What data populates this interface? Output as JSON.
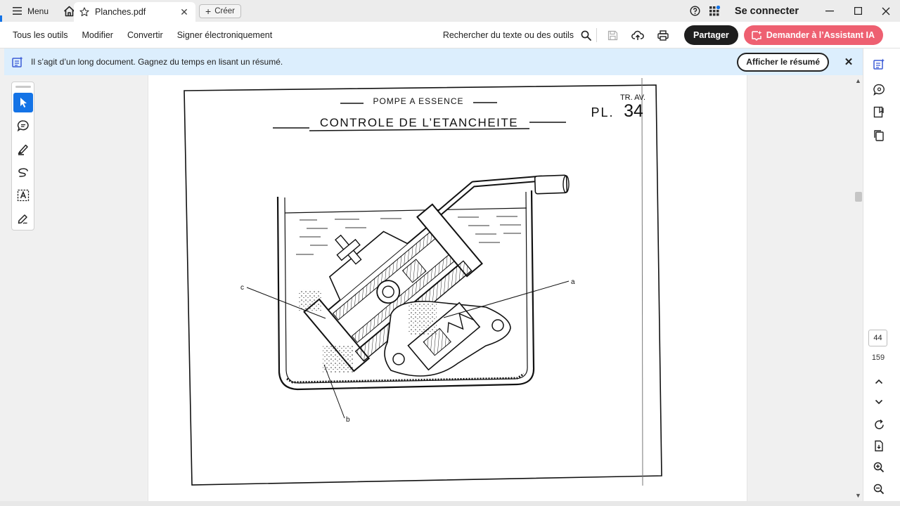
{
  "titlebar": {
    "menu_label": "Menu",
    "tab_title": "Planches.pdf",
    "new_tab_label": "Créer",
    "signin_label": "Se connecter"
  },
  "toolbar": {
    "menus": [
      "Tous les outils",
      "Modifier",
      "Convertir",
      "Signer électroniquement"
    ],
    "search_label": "Rechercher du texte ou des outils",
    "share_label": "Partager",
    "ai_label": "Demander à l’Assistant IA"
  },
  "banner": {
    "text": "Il s’agit d’un long document. Gagnez du temps en lisant un résumé.",
    "summary_button": "Afficher le résumé"
  },
  "document": {
    "header_small": "POMPE A ESSENCE",
    "header_title": "CONTROLE DE L’ETANCHEITE",
    "plate_section": "TR. AV.",
    "plate_prefix": "PL.",
    "plate_number": "34",
    "callout_a": "a",
    "callout_b": "b",
    "callout_c": "c"
  },
  "navigation": {
    "current_page": "44",
    "total_pages": "159"
  },
  "colors": {
    "accent_blue": "#1473e6",
    "ai_button": "#ee6071",
    "banner_bg": "#dceefd",
    "share_button": "#1e1e1e"
  }
}
